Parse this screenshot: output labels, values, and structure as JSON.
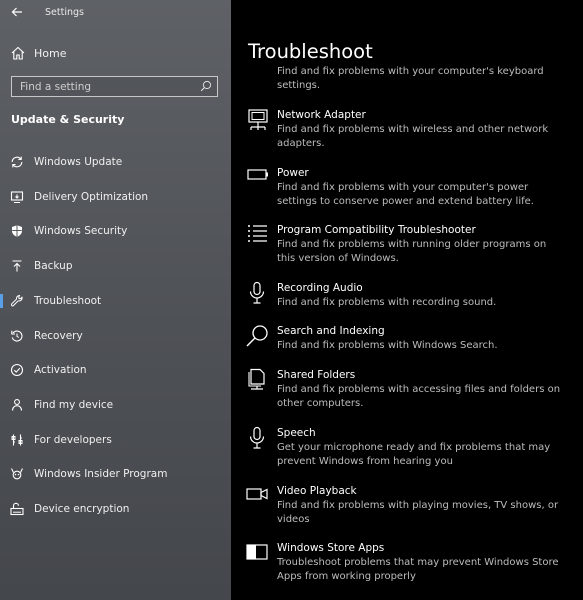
{
  "window": {
    "app_title": "Settings",
    "back_icon": "back-arrow-icon"
  },
  "sidebar": {
    "home_label": "Home",
    "search_placeholder": "Find a setting",
    "section_title": "Update & Security",
    "accent_color": "#5aa0e8",
    "items": [
      {
        "label": "Windows Update",
        "icon": "sync-icon"
      },
      {
        "label": "Delivery Optimization",
        "icon": "delivery-icon"
      },
      {
        "label": "Windows Security",
        "icon": "shield-icon"
      },
      {
        "label": "Backup",
        "icon": "backup-icon"
      },
      {
        "label": "Troubleshoot",
        "icon": "wrench-icon",
        "selected": true
      },
      {
        "label": "Recovery",
        "icon": "recovery-icon"
      },
      {
        "label": "Activation",
        "icon": "check-circle-icon"
      },
      {
        "label": "Find my device",
        "icon": "person-icon"
      },
      {
        "label": "For developers",
        "icon": "developer-icon"
      },
      {
        "label": "Windows Insider Program",
        "icon": "insider-icon"
      },
      {
        "label": "Device encryption",
        "icon": "encryption-icon"
      }
    ]
  },
  "main": {
    "title": "Troubleshoot",
    "partial_top_desc": "Find and fix problems with your computer's keyboard settings.",
    "troubleshooters": [
      {
        "title": "Network Adapter",
        "desc": "Find and fix problems with wireless and other network adapters.",
        "icon": "network-adapter-icon"
      },
      {
        "title": "Power",
        "desc": "Find and fix problems with your computer's power settings to conserve power and extend battery life.",
        "icon": "battery-icon"
      },
      {
        "title": "Program Compatibility Troubleshooter",
        "desc": "Find and fix problems with running older programs on this version of Windows.",
        "icon": "list-icon"
      },
      {
        "title": "Recording Audio",
        "desc": "Find and fix problems with recording sound.",
        "icon": "microphone-icon"
      },
      {
        "title": "Search and Indexing",
        "desc": "Find and fix problems with Windows Search.",
        "icon": "search-icon"
      },
      {
        "title": "Shared Folders",
        "desc": "Find and fix problems with accessing files and folders on other computers.",
        "icon": "shared-folder-icon"
      },
      {
        "title": "Speech",
        "desc": "Get your microphone ready and fix problems that may prevent Windows from hearing you",
        "icon": "speech-microphone-icon"
      },
      {
        "title": "Video Playback",
        "desc": "Find and fix problems with playing movies, TV shows, or videos",
        "icon": "video-camera-icon"
      },
      {
        "title": "Windows Store Apps",
        "desc": "Troubleshoot problems that may prevent Windows Store Apps from working properly",
        "icon": "store-apps-icon"
      }
    ]
  }
}
